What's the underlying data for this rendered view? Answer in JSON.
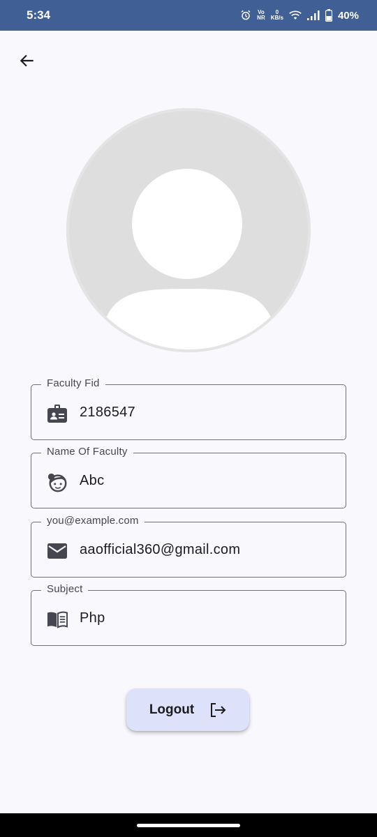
{
  "status_bar": {
    "time": "5:34",
    "volte_top": "Vo",
    "volte_bottom": "NR",
    "speed_top": "0",
    "speed_bottom": "KB/s",
    "battery": "40%"
  },
  "fields": [
    {
      "label": "Faculty Fid",
      "value": "2186547",
      "icon": "badge-icon"
    },
    {
      "label": "Name Of Faculty",
      "value": "Abc",
      "icon": "face-icon"
    },
    {
      "label": "you@example.com",
      "value": "aaofficial360@gmail.com",
      "icon": "mail-icon"
    },
    {
      "label": "Subject",
      "value": "Php",
      "icon": "book-icon"
    }
  ],
  "logout": {
    "label": "Logout"
  },
  "colors": {
    "status_bar": "#3f5f95",
    "background": "#f8f8fd",
    "button": "#dde1f9",
    "avatar": "#dedede"
  }
}
